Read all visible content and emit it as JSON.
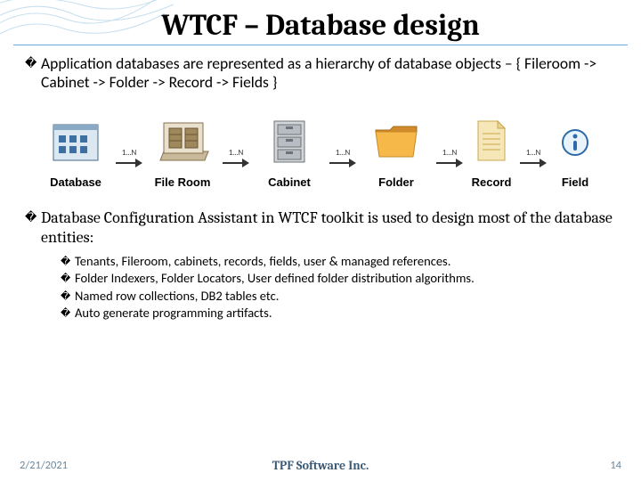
{
  "title": "WTCF – Database design",
  "bullets": {
    "b1": "Application databases are represented as a hierarchy of database objects – { Fileroom -> Cabinet -> Folder -> Record -> Fields }",
    "b2": "Database Configuration Assistant in WTCF toolkit is used to design most of the database entities:"
  },
  "sub": {
    "s1": "Tenants, Fileroom, cabinets, records, fields, user & managed references.",
    "s2": "Folder Indexers, Folder Locators, User defined folder distribution algorithms.",
    "s3": " Named row collections, DB2 tables etc.",
    "s4": "Auto generate programming artifacts."
  },
  "diagram": {
    "arrow_caption": "1…N",
    "labels": {
      "database": "Database",
      "fileroom": "File Room",
      "cabinet": "Cabinet",
      "folder": "Folder",
      "record": "Record",
      "field": "Field"
    }
  },
  "footer": {
    "date": "2/21/2021",
    "org": "TPF Software Inc.",
    "page": "14"
  },
  "marker": "�"
}
